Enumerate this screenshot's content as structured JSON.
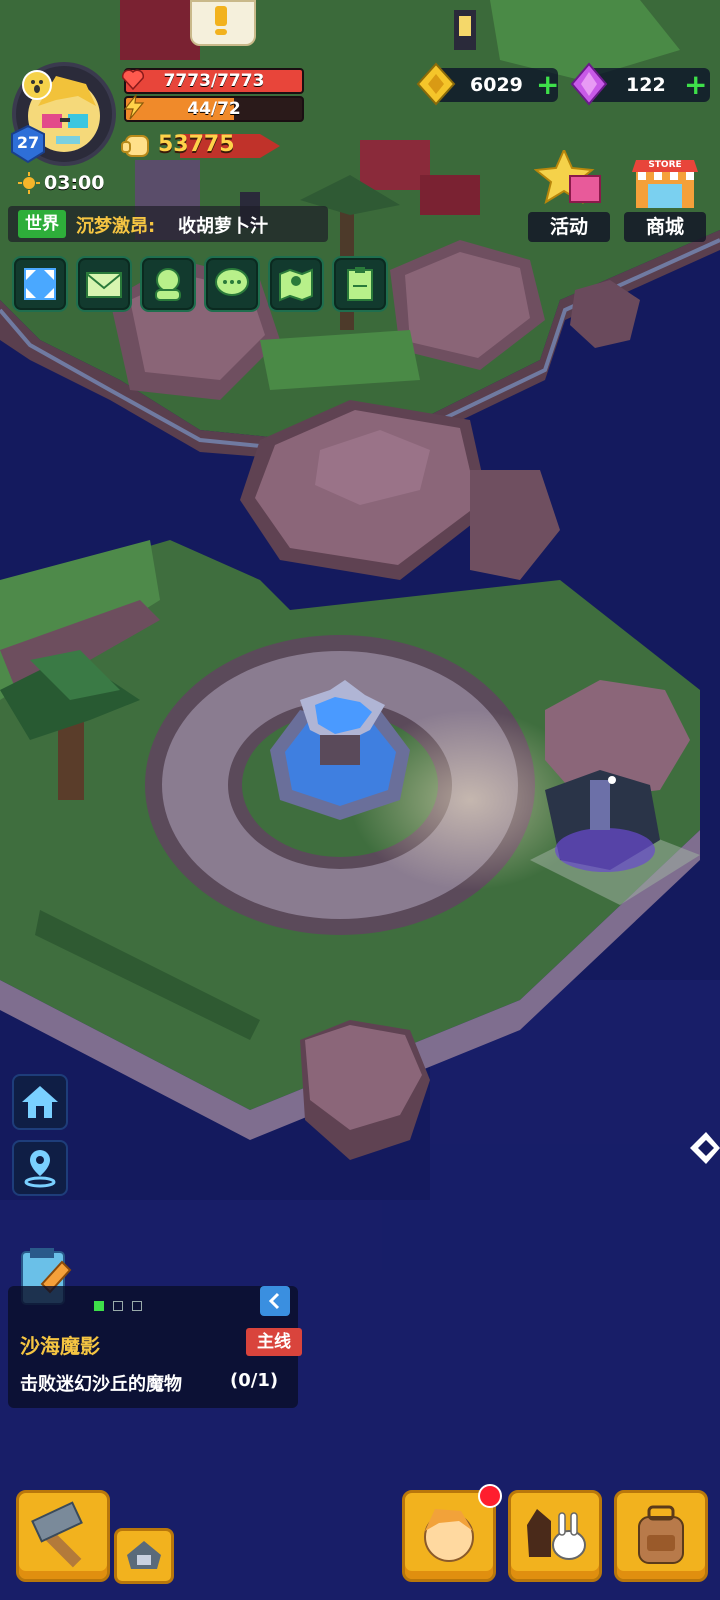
{
  "player": {
    "level": "27",
    "hp_text": "7773/7773",
    "hp_fraction": 1.0,
    "energy_text": "44/72",
    "energy_fraction": 0.611,
    "power": "53775",
    "timer": "03:00"
  },
  "currency": {
    "gold": "6029",
    "gems": "122"
  },
  "chat": {
    "channel": "世界",
    "sender": "沉梦激昂:",
    "message": "收胡萝卜汁"
  },
  "shop_buttons": {
    "events_label": "活动",
    "store_label": "商城",
    "store_badge": "STORE"
  },
  "quest": {
    "title": "沙海魔影",
    "tag": "主线",
    "objective": "击败迷幻沙丘的魔物",
    "progress": "(0/1)",
    "page_dots": 3,
    "active_dot": 0
  },
  "colors": {
    "ocean": "#141a5e",
    "hp_fill": "#e8453a",
    "energy_fill": "#f08a2a",
    "quest_title": "#f5c542",
    "tag_bg": "#d9443c",
    "button_gold": "#f2b21e"
  },
  "icons": {
    "top_menu": [
      "expand-icon",
      "mail-icon",
      "friends-icon",
      "chat-icon",
      "map-icon",
      "clipboard-icon"
    ],
    "side": [
      "home-icon",
      "location-pin-icon"
    ],
    "bottom": [
      "hammer-icon",
      "build-icon",
      "hero-icon",
      "pets-icon",
      "backpack-icon"
    ]
  }
}
